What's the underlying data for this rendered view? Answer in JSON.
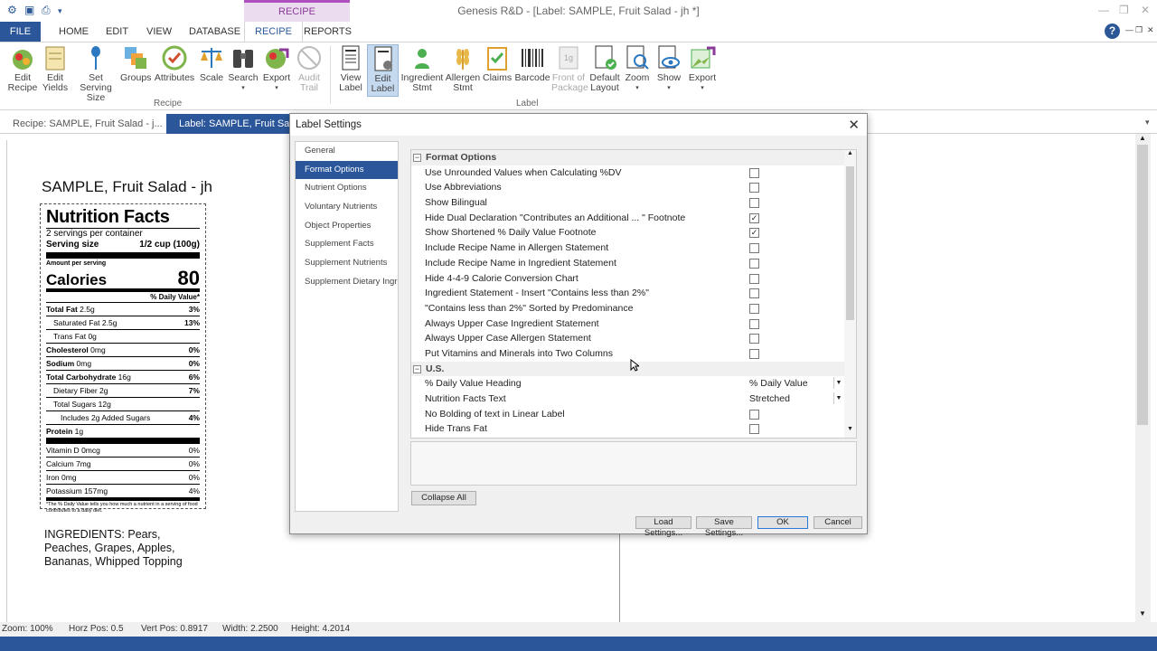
{
  "app": {
    "title": "Genesis R&D - [Label: SAMPLE, Fruit Salad - jh *]",
    "context_tab": "RECIPE"
  },
  "menu": {
    "file": "FILE",
    "tabs": [
      "HOME",
      "EDIT",
      "VIEW",
      "DATABASE",
      "RECIPE",
      "REPORTS"
    ],
    "help": "?"
  },
  "ribbon": {
    "recipe_group": {
      "label": "Recipe",
      "buttons": [
        "Edit\nRecipe",
        "Edit\nYields",
        "Set Serving\nSize",
        "Groups",
        "Attributes",
        "Scale",
        "Search",
        "Export",
        "Audit\nTrail"
      ]
    },
    "label_group": {
      "label": "Label",
      "buttons": [
        "View\nLabel",
        "Edit\nLabel",
        "Ingredient\nStmt",
        "Allergen\nStmt",
        "Claims",
        "Barcode",
        "Front of\nPackage",
        "Default\nLayout",
        "Zoom",
        "Show",
        "Export"
      ]
    }
  },
  "doc_tabs": [
    "Recipe: SAMPLE, Fruit Salad - j...",
    "Label: SAMPLE, Fruit Salad -"
  ],
  "label": {
    "recipe_title": "SAMPLE, Fruit Salad - jh",
    "nf_title": "Nutrition Facts",
    "servings": "2 servings per container",
    "serving_size_label": "Serving size",
    "serving_size_value": "1/2 cup (100g)",
    "amount_per_serving": "Amount per serving",
    "calories_label": "Calories",
    "calories_value": "80",
    "dv_header": "% Daily Value*",
    "rows": [
      {
        "name": "Total Fat",
        "amt": "2.5g",
        "dv": "3%",
        "bold": true,
        "indent": 0
      },
      {
        "name": "Saturated Fat",
        "amt": "2.5g",
        "dv": "13%",
        "bold": false,
        "indent": 1
      },
      {
        "name": "Trans Fat",
        "amt": "0g",
        "dv": "",
        "bold": false,
        "indent": 1
      },
      {
        "name": "Cholesterol",
        "amt": "0mg",
        "dv": "0%",
        "bold": true,
        "indent": 0
      },
      {
        "name": "Sodium",
        "amt": "0mg",
        "dv": "0%",
        "bold": true,
        "indent": 0
      },
      {
        "name": "Total Carbohydrate",
        "amt": "16g",
        "dv": "6%",
        "bold": true,
        "indent": 0
      },
      {
        "name": "Dietary Fiber",
        "amt": "2g",
        "dv": "7%",
        "bold": false,
        "indent": 1
      },
      {
        "name": "Total Sugars",
        "amt": "12g",
        "dv": "",
        "bold": false,
        "indent": 1
      },
      {
        "name": "Includes 2g Added Sugars",
        "amt": "",
        "dv": "4%",
        "bold": false,
        "indent": 2
      },
      {
        "name": "Protein",
        "amt": "1g",
        "dv": "",
        "bold": true,
        "indent": 0
      }
    ],
    "vitamins": [
      {
        "name": "Vitamin D",
        "amt": "0mcg",
        "dv": "0%"
      },
      {
        "name": "Calcium",
        "amt": "7mg",
        "dv": "0%"
      },
      {
        "name": "Iron",
        "amt": "0mg",
        "dv": "0%"
      },
      {
        "name": "Potassium",
        "amt": "157mg",
        "dv": "4%"
      }
    ],
    "footnote": "*The % Daily Value tells you how much a nutrient in a serving of food contributes to a daily diet.",
    "ingredients": "INGREDIENTS: Pears, Peaches, Grapes, Apples, Bananas, Whipped Topping"
  },
  "dialog": {
    "title": "Label Settings",
    "nav": [
      "General",
      "Format Options",
      "Nutrient Options",
      "Voluntary Nutrients",
      "Object Properties",
      "Supplement Facts",
      "Supplement Nutrients",
      "Supplement Dietary Ingre"
    ],
    "active_nav": "Format Options",
    "sections": [
      {
        "title": "Format Options",
        "props": [
          {
            "label": "Use Unrounded Values when Calculating %DV",
            "checked": false
          },
          {
            "label": "Use Abbreviations",
            "checked": false
          },
          {
            "label": "Show Bilingual",
            "checked": false
          },
          {
            "label": "Hide Dual Declaration \"Contributes an Additional ... \" Footnote",
            "checked": true
          },
          {
            "label": "Show Shortened % Daily Value Footnote",
            "checked": true
          },
          {
            "label": "Include Recipe Name in Allergen Statement",
            "checked": false
          },
          {
            "label": "Include Recipe Name in Ingredient Statement",
            "checked": false
          },
          {
            "label": "Hide 4-4-9 Calorie Conversion Chart",
            "checked": false
          },
          {
            "label": "Ingredient Statement - Insert \"Contains less than 2%\"",
            "checked": false
          },
          {
            "label": "\"Contains less than 2%\" Sorted by Predominance",
            "checked": false
          },
          {
            "label": "Always Upper Case Ingredient Statement",
            "checked": false
          },
          {
            "label": "Always Upper Case Allergen Statement",
            "checked": false
          },
          {
            "label": "Put Vitamins and Minerals into Two Columns",
            "checked": false
          }
        ]
      },
      {
        "title": "U.S.",
        "props": [
          {
            "label": "% Daily Value Heading",
            "value": "% Daily Value"
          },
          {
            "label": "Nutrition Facts Text",
            "value": "Stretched"
          },
          {
            "label": "No Bolding of text in Linear Label",
            "checked": false
          },
          {
            "label": "Hide Trans Fat",
            "checked": false
          }
        ]
      }
    ],
    "buttons": {
      "collapse_all": "Collapse All",
      "load": "Load Settings...",
      "save": "Save Settings...",
      "ok": "OK",
      "cancel": "Cancel"
    }
  },
  "status": {
    "zoom": "Zoom:  100%",
    "horz": "Horz Pos:  0.5",
    "vert": "Vert Pos:  0.8917",
    "width": "Width:  2.2500",
    "height": "Height:  4.2014"
  },
  "colors": {
    "accent": "#2b579a",
    "context": "#b04fc0"
  }
}
